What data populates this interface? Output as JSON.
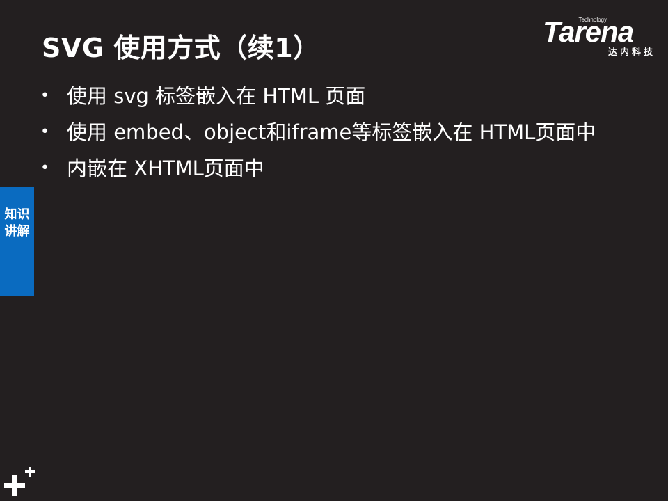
{
  "slide": {
    "title": "SVG 使用方式（续1）",
    "bullets": [
      "使用 svg 标签嵌入在 HTML 页面",
      "使用 embed、object和iframe等标签嵌入在 HTML页面中",
      "内嵌在 XHTML页面中"
    ],
    "bullet_symbol": "•"
  },
  "logo": {
    "brand": "Tarena",
    "tagline": "Technology",
    "chinese": "达内科技"
  },
  "sidetab": {
    "label": "知识讲解",
    "color": "#0a6bc0"
  },
  "decor": {
    "corner_icon": "plus-icon"
  },
  "colors": {
    "background": "#231f20",
    "text": "#ffffff",
    "accent": "#0a6bc0"
  }
}
